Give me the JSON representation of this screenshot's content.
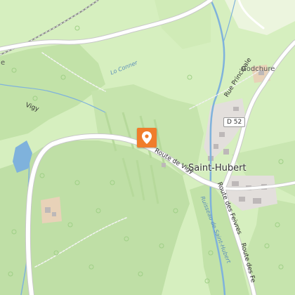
{
  "map": {
    "labels": {
      "vigy": "Vigy",
      "lo_conner": "Lo Conner",
      "godchure": "Godchure",
      "rue_principale": "Rue Principale",
      "road_shield": "D 52",
      "saint_hubert": "Saint-Hubert",
      "route_de_vigy": "Route de Vigy",
      "route_des_feivres_1": "Route des Feivres",
      "route_des_feivres_2": "Route des Fe",
      "ruisseau": "Ruisseau de Saint-Hubert",
      "edge_e": "e"
    },
    "marker": {
      "icon": "location-pin-icon",
      "color": "#f07d2b"
    },
    "colors": {
      "forest": "#bfdfa6",
      "meadow": "#d8f0c2",
      "water": "#7fb2dc",
      "road": "#ffffff",
      "buildings": "#c9c4c4",
      "residential": "#e2dedd",
      "railway": "#777777",
      "marker": "#f07d2b"
    }
  }
}
